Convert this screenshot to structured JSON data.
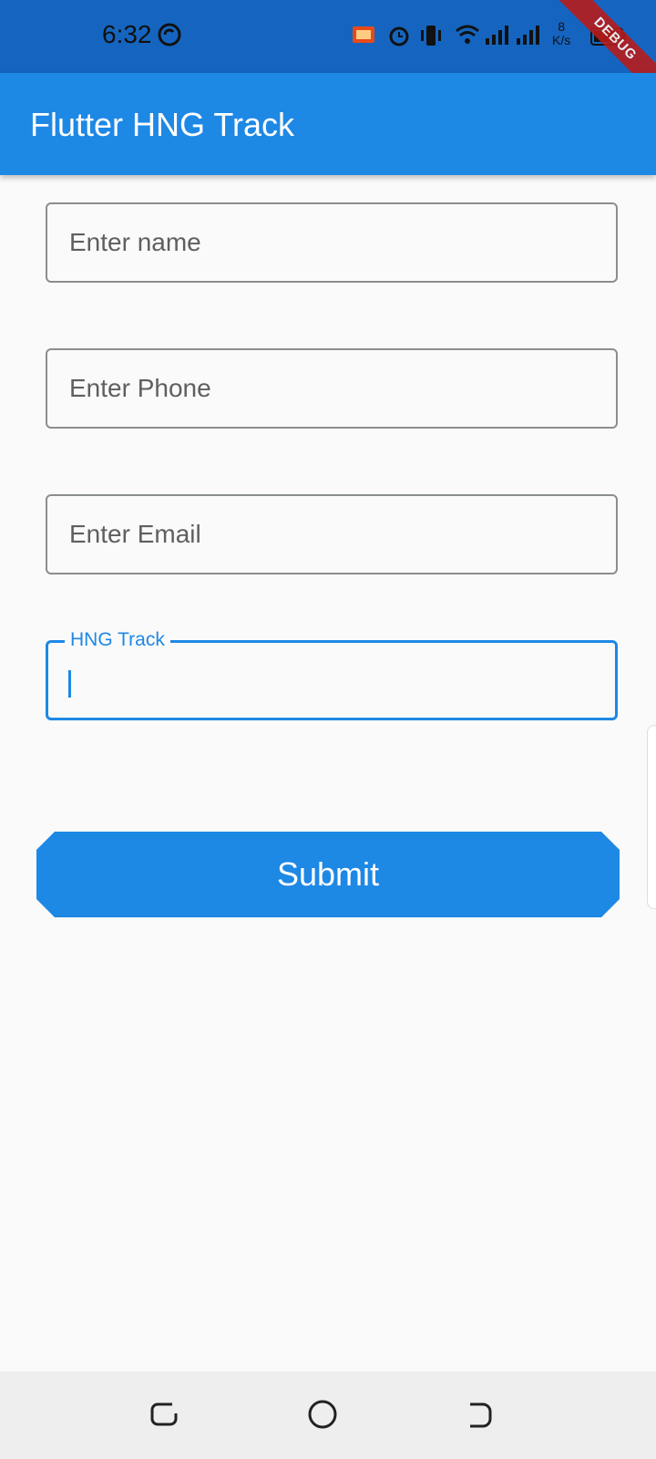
{
  "status_bar": {
    "time": "6:32",
    "net_speed_value": "8",
    "net_speed_unit": "K/s",
    "debug_banner": "DEBUG",
    "icons": [
      "sync-icon",
      "cast-icon",
      "alarm-icon",
      "vibrate-icon",
      "wifi-icon",
      "signal-icon",
      "signal-icon",
      "battery-icon"
    ]
  },
  "app_bar": {
    "title": "Flutter HNG Track",
    "color": "#1e88e5"
  },
  "form": {
    "name_placeholder": "Enter name",
    "phone_placeholder": "Enter Phone",
    "email_placeholder": "Enter Email",
    "track_label": "HNG Track",
    "track_value": "",
    "submit_label": "Submit"
  },
  "nav_bar": {
    "icons": [
      "recents-icon",
      "home-icon",
      "back-icon"
    ]
  },
  "colors": {
    "accent": "#1e88e5",
    "status_bar": "#1565c0",
    "background": "#fafafa"
  }
}
